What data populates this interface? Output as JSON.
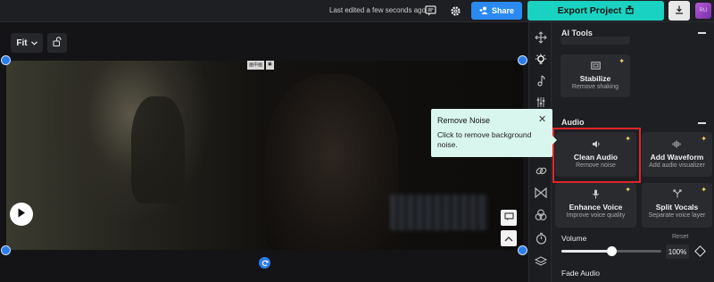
{
  "topbar": {
    "last_edited": "Last edited a few seconds ago",
    "share_label": "Share",
    "export_label": "Export Project",
    "avatar_initials": "RU",
    "accent": "#19d2c1",
    "share_color": "#2b8af0"
  },
  "canvas": {
    "fit_label": "Fit",
    "video_tags": [
      "画中画",
      "▣"
    ],
    "blur_text": "w2Z87.com"
  },
  "rail": {
    "icons": [
      "move-icon",
      "lightbulb-icon",
      "music-note-icon",
      "adjust-icon",
      "link-icon",
      "transition-icon",
      "color-icon",
      "timer-icon",
      "layers-icon"
    ]
  },
  "panel": {
    "ai_tools": {
      "heading": "AI Tools",
      "stabilize": {
        "title": "Stabilize",
        "sub": "Remove shaking"
      }
    },
    "audio": {
      "heading": "Audio",
      "cards": [
        {
          "title": "Clean Audio",
          "sub": "Remove noise"
        },
        {
          "title": "Add Waveform",
          "sub": "Add audio visualizer"
        },
        {
          "title": "Enhance Voice",
          "sub": "Improve voice quality"
        },
        {
          "title": "Split Vocals",
          "sub": "Separate voice layer"
        }
      ]
    },
    "volume": {
      "label": "Volume",
      "reset_label": "Reset",
      "value_text": "100%",
      "level": 0.5
    },
    "fade_label": "Fade Audio"
  },
  "tooltip": {
    "title": "Remove Noise",
    "body": "Click to remove background noise."
  },
  "colors": {
    "highlight": "#e0252b",
    "tooltip_bg": "#d9f6ee",
    "handle": "#2b7de9"
  }
}
